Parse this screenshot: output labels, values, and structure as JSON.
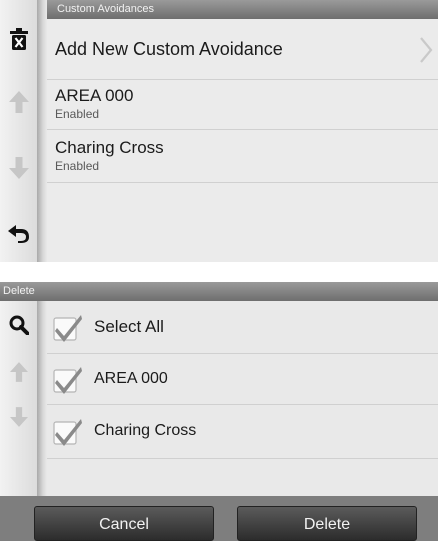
{
  "custom_avoidances": {
    "header": "Custom Avoidances",
    "items": [
      {
        "title": "Add New Custom Avoidance"
      },
      {
        "title": "AREA 000",
        "status": "Enabled"
      },
      {
        "title": "Charing Cross",
        "status": "Enabled"
      }
    ],
    "sidebar_icons": [
      "trash-icon",
      "arrow-up-icon",
      "arrow-down-icon",
      "back-icon"
    ]
  },
  "delete_screen": {
    "header": "Delete",
    "items": [
      {
        "label": "Select All",
        "checked": true
      },
      {
        "label": "AREA 000",
        "checked": true
      },
      {
        "label": "Charing Cross",
        "checked": true
      }
    ],
    "sidebar_icons": [
      "search-icon",
      "arrow-up-icon",
      "arrow-down-icon"
    ],
    "buttons": {
      "cancel": "Cancel",
      "delete": "Delete"
    }
  }
}
